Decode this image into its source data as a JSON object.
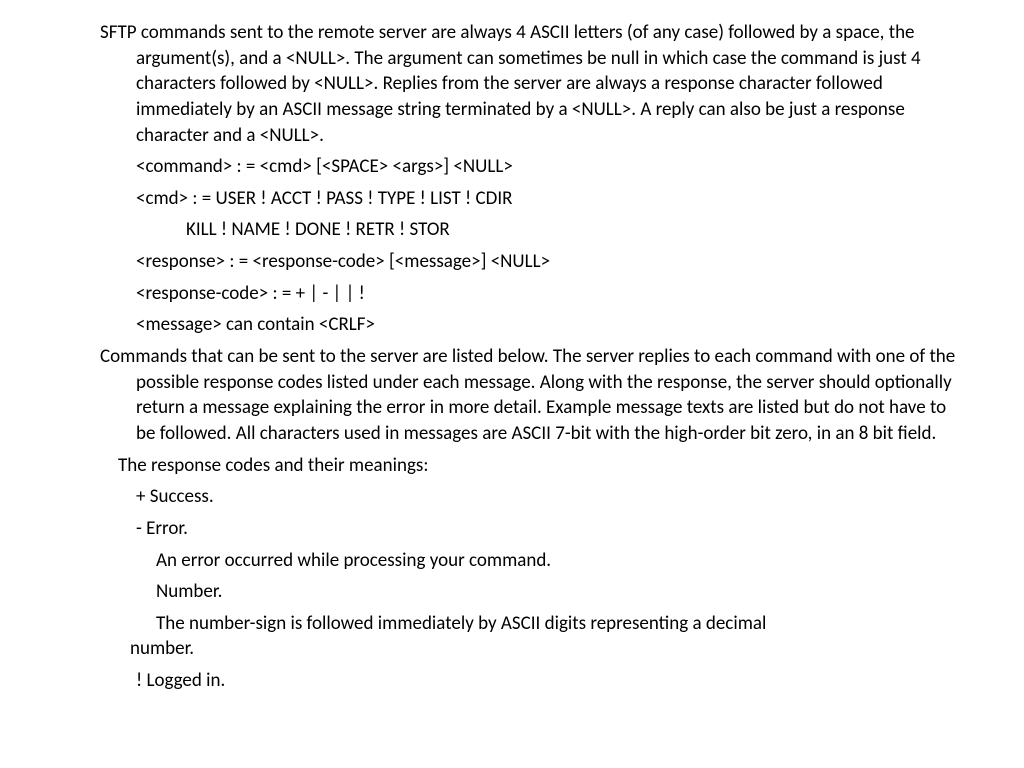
{
  "doc": {
    "p1": "SFTP commands sent to the remote server are always 4 ASCII letters (of any case) followed by a space, the argument(s), and a <NULL>.  The argument can sometimes be null in which case the command is just 4 characters followed by <NULL>.  Replies from the server are always a response character followed immediately by an ASCII message string terminated by a <NULL>.  A reply can also be just a response character and a <NULL>.",
    "s1": "<command> : = <cmd> [<SPACE> <args>] <NULL>",
    "s2": "<cmd> : =  USER ! ACCT ! PASS ! TYPE ! LIST ! CDIR",
    "s2b": "KILL ! NAME ! DONE ! RETR ! STOR",
    "s3": "<response> : = <response-code> [<message>] <NULL>",
    "s4": "<response-code> : =  + | - |    | !",
    "s5": "<message> can contain <CRLF>",
    "p2": "Commands that can be sent to the server are listed below.  The server replies to each command with one of the possible response codes listed under each message.  Along with the response, the server should optionally return a message explaining the error in more detail.  Example message texts are listed but do not have to be followed.  All characters used in messages are ASCII 7-bit with the high-order bit zero, in an 8 bit field.",
    "respIntro": "The response codes and their meanings:",
    "r1": "+  Success.",
    "r2": "-  Error.",
    "r2d1": "An error occurred while processing your command.",
    "r2d2": "Number.",
    "r2d3": "The number-sign is followed immediately by ASCII digits representing a decimal number.",
    "r3": "!  Logged in."
  }
}
